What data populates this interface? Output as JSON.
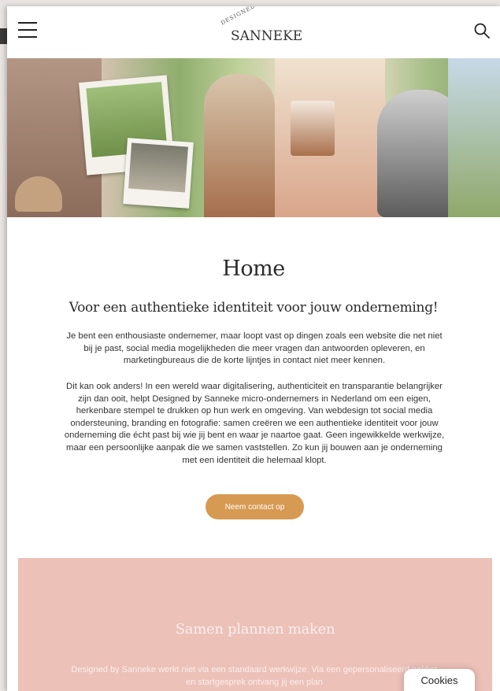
{
  "header": {
    "menu_icon": "hamburger-menu-icon",
    "logo_small": "DESIGNED • BY",
    "logo_main": "SANNEKE",
    "search_icon": "search-icon"
  },
  "hero": {
    "description_icon": "collage-image"
  },
  "main": {
    "title": "Home",
    "subtitle": "Voor een authentieke identiteit voor jouw onderneming!",
    "paragraph1": "Je bent een enthousiaste ondernemer, maar loopt vast op dingen zoals een website die net niet bij je past, social media mogelijkheden die meer vragen dan antwoorden opleveren, en marketingbureaus die de korte lijntjes in contact niet meer kennen.",
    "paragraph2": "Dit kan ook anders! In een wereld waar digitalisering, authenticiteit en transparantie belangrijker zijn dan ooit, helpt Designed by Sanneke micro-ondernemers in Nederland om een eigen, herkenbare stempel te drukken op hun werk en omgeving. Van webdesign tot social media ondersteuning, branding en fotografie: samen creëren we een authentieke identiteit voor jouw onderneming die écht past bij wie jij bent en waar je naartoe gaat. Geen ingewikkelde werkwijze, maar een persoonlijke aanpak die we samen vaststellen. Zo kun jij bouwen aan je onderneming met een identiteit die helemaal klopt.",
    "cta_label": "Neem contact op"
  },
  "section": {
    "title": "Samen plannen maken",
    "text": "Designed by Sanneke werkt niet via een standaard werkwijze. Via een gepersonaliseerd pakket en startgesprek ontvang jij een plan"
  },
  "cookies_label": "Cookies",
  "colors": {
    "accent": "#d79a52",
    "section_bg": "#ecc1b8"
  }
}
